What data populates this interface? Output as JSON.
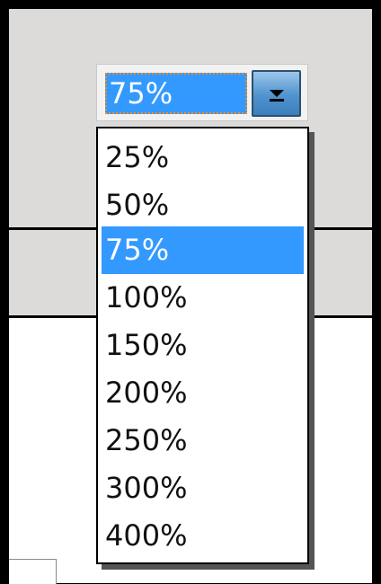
{
  "zoom": {
    "current": "75%",
    "options": [
      "25%",
      "50%",
      "75%",
      "100%",
      "150%",
      "200%",
      "250%",
      "300%",
      "400%"
    ],
    "selected_index": 2
  },
  "colors": {
    "highlight": "#3399ff",
    "focus_ring": "#ff8a1a",
    "panel": "#dcdbda"
  },
  "icons": {
    "dropdown_button": "chevron-down-icon"
  }
}
